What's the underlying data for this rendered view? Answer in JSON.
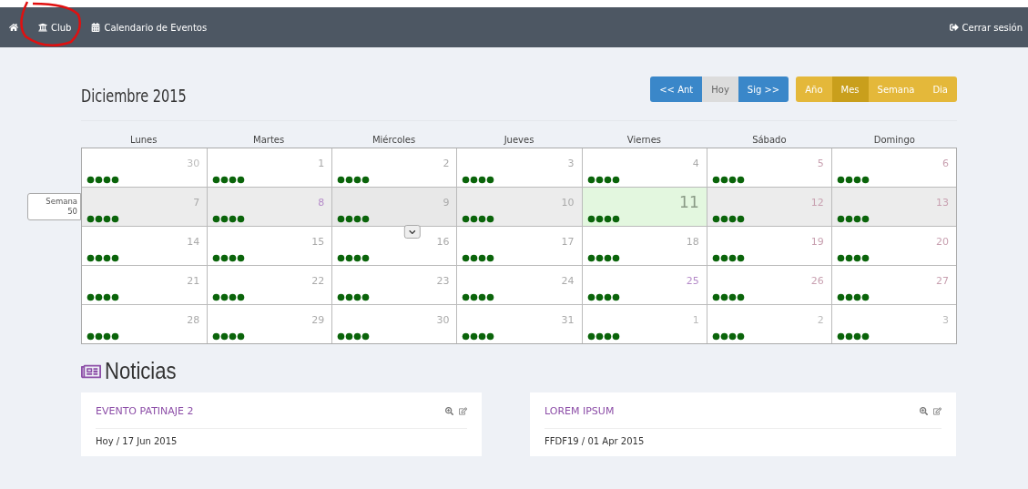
{
  "navbar": {
    "items": [
      {
        "kind": "home"
      },
      {
        "kind": "club",
        "label": "Club",
        "annotated": true
      },
      {
        "kind": "calendar",
        "label": "Calendario de Eventos"
      }
    ],
    "logout": "Cerrar sesión"
  },
  "calendar": {
    "title": "Diciembre 2015",
    "nav_buttons": [
      {
        "label": "<< Ant",
        "kind": "primary"
      },
      {
        "label": "Hoy",
        "kind": "neutral"
      },
      {
        "label": "Sig >>",
        "kind": "primary"
      }
    ],
    "view_buttons": [
      {
        "label": "Año",
        "selected": false
      },
      {
        "label": "Mes",
        "selected": true
      },
      {
        "label": "Semana",
        "selected": false
      },
      {
        "label": "Dia",
        "selected": false
      }
    ],
    "weekdays": [
      "Lunes",
      "Martes",
      "Miércoles",
      "Jueves",
      "Viernes",
      "Sábado",
      "Domingo"
    ],
    "weeks": [
      {
        "hovered": false,
        "days": [
          {
            "day": "30",
            "kind": "other",
            "today": false,
            "hovered": false
          },
          {
            "day": "1",
            "kind": "normal",
            "today": false,
            "hovered": false
          },
          {
            "day": "2",
            "kind": "normal",
            "today": false,
            "hovered": false
          },
          {
            "day": "3",
            "kind": "normal",
            "today": false,
            "hovered": false
          },
          {
            "day": "4",
            "kind": "normal",
            "today": false,
            "hovered": false
          },
          {
            "day": "5",
            "kind": "weekend",
            "today": false,
            "hovered": false
          },
          {
            "day": "6",
            "kind": "weekend",
            "today": false,
            "hovered": false
          }
        ]
      },
      {
        "hovered": true,
        "week_label": "Semana",
        "week_number": "50",
        "days": [
          {
            "day": "7",
            "kind": "normal",
            "today": false,
            "hovered": false
          },
          {
            "day": "8",
            "kind": "holiday",
            "today": false,
            "hovered": false
          },
          {
            "day": "9",
            "kind": "normal",
            "today": false,
            "hovered": true
          },
          {
            "day": "10",
            "kind": "normal",
            "today": false,
            "hovered": false
          },
          {
            "day": "11",
            "kind": "normal",
            "today": true,
            "hovered": false
          },
          {
            "day": "12",
            "kind": "weekend",
            "today": false,
            "hovered": false
          },
          {
            "day": "13",
            "kind": "weekend",
            "today": false,
            "hovered": false
          }
        ]
      },
      {
        "hovered": false,
        "days": [
          {
            "day": "14",
            "kind": "normal",
            "today": false,
            "hovered": false
          },
          {
            "day": "15",
            "kind": "normal",
            "today": false,
            "hovered": false
          },
          {
            "day": "16",
            "kind": "normal",
            "today": false,
            "hovered": false
          },
          {
            "day": "17",
            "kind": "normal",
            "today": false,
            "hovered": false
          },
          {
            "day": "18",
            "kind": "normal",
            "today": false,
            "hovered": false
          },
          {
            "day": "19",
            "kind": "weekend",
            "today": false,
            "hovered": false
          },
          {
            "day": "20",
            "kind": "weekend",
            "today": false,
            "hovered": false
          }
        ]
      },
      {
        "hovered": false,
        "days": [
          {
            "day": "21",
            "kind": "normal",
            "today": false,
            "hovered": false
          },
          {
            "day": "22",
            "kind": "normal",
            "today": false,
            "hovered": false
          },
          {
            "day": "23",
            "kind": "normal",
            "today": false,
            "hovered": false
          },
          {
            "day": "24",
            "kind": "normal",
            "today": false,
            "hovered": false
          },
          {
            "day": "25",
            "kind": "holiday",
            "today": false,
            "hovered": false
          },
          {
            "day": "26",
            "kind": "weekend",
            "today": false,
            "hovered": false
          },
          {
            "day": "27",
            "kind": "weekend",
            "today": false,
            "hovered": false
          }
        ]
      },
      {
        "hovered": false,
        "days": [
          {
            "day": "28",
            "kind": "normal",
            "today": false,
            "hovered": false
          },
          {
            "day": "29",
            "kind": "normal",
            "today": false,
            "hovered": false
          },
          {
            "day": "30",
            "kind": "normal",
            "today": false,
            "hovered": false
          },
          {
            "day": "31",
            "kind": "normal",
            "today": false,
            "hovered": false
          },
          {
            "day": "1",
            "kind": "other",
            "today": false,
            "hovered": false
          },
          {
            "day": "2",
            "kind": "other",
            "today": false,
            "hovered": false
          },
          {
            "day": "3",
            "kind": "other",
            "today": false,
            "hovered": false
          }
        ]
      }
    ]
  },
  "news": {
    "title": "Noticias",
    "cards": [
      {
        "title": "EVENTO PATINAJE 2",
        "subtitle": "Hoy / 17 Jun 2015"
      },
      {
        "title": "LOREM IPSUM",
        "subtitle": "FFDF19 / 01 Apr 2015"
      }
    ]
  }
}
